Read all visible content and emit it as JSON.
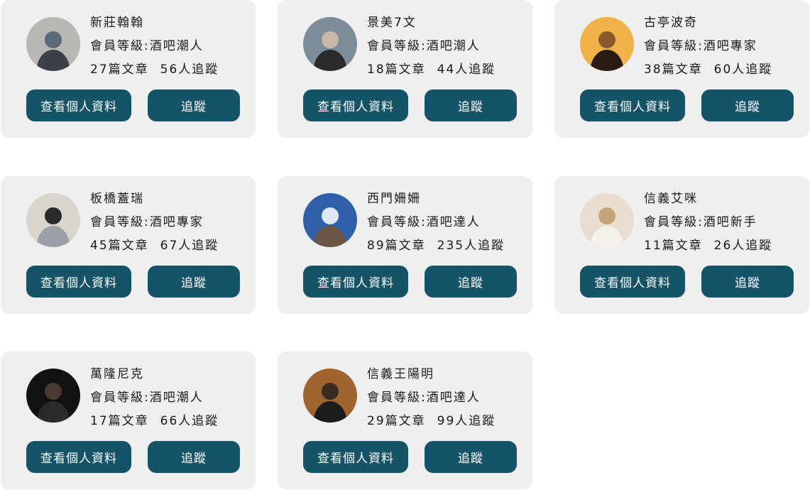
{
  "cards": [
    {
      "name": "新莊翰翰",
      "level": "會員等級:酒吧潮人",
      "articles": "27篇文章",
      "followers": "56人追蹤",
      "profile_label": "查看個人資料",
      "follow_label": "追蹤",
      "avatar_colors": [
        "#b9b7b3",
        "#5a6a7a",
        "#3a3f48"
      ]
    },
    {
      "name": "景美7文",
      "level": "會員等級:酒吧潮人",
      "articles": "18篇文章",
      "followers": "44人追蹤",
      "profile_label": "查看個人資料",
      "follow_label": "追蹤",
      "avatar_colors": [
        "#7d8c9a",
        "#c9b8a8",
        "#2a2a2a"
      ]
    },
    {
      "name": "古亭波奇",
      "level": "會員等級:酒吧專家",
      "articles": "38篇文章",
      "followers": "60人追蹤",
      "profile_label": "查看個人資料",
      "follow_label": "追蹤",
      "avatar_colors": [
        "#f2b24a",
        "#8a5a2a",
        "#2a1c14"
      ]
    },
    {
      "name": "板橋蓋瑞",
      "level": "會員等級:酒吧專家",
      "articles": "45篇文章",
      "followers": "67人追蹤",
      "profile_label": "查看個人資料",
      "follow_label": "追蹤",
      "avatar_colors": [
        "#d9d4cc",
        "#2a2a2a",
        "#9aa0a6"
      ]
    },
    {
      "name": "西門姍姍",
      "level": "會員等級:酒吧達人",
      "articles": "89篇文章",
      "followers": "235人追蹤",
      "profile_label": "查看個人資料",
      "follow_label": "追蹤",
      "avatar_colors": [
        "#2f5fa8",
        "#dfe8f2",
        "#6a5444"
      ]
    },
    {
      "name": "信義艾咪",
      "level": "會員等級:酒吧新手",
      "articles": "11篇文章",
      "followers": "26人追蹤",
      "profile_label": "查看個人資料",
      "follow_label": "追蹤",
      "avatar_colors": [
        "#e8ddd0",
        "#c7a37c",
        "#f5f1ea"
      ]
    },
    {
      "name": "萬隆尼克",
      "level": "會員等級:酒吧潮人",
      "articles": "17篇文章",
      "followers": "66人追蹤",
      "profile_label": "查看個人資料",
      "follow_label": "追蹤",
      "avatar_colors": [
        "#111111",
        "#4a3a30",
        "#2a2a2a"
      ]
    },
    {
      "name": "信義王陽明",
      "level": "會員等級:酒吧達人",
      "articles": "29篇文章",
      "followers": "99人追蹤",
      "profile_label": "查看個人資料",
      "follow_label": "追蹤",
      "avatar_colors": [
        "#a0642e",
        "#3a2a22",
        "#1c1c1c"
      ]
    }
  ]
}
